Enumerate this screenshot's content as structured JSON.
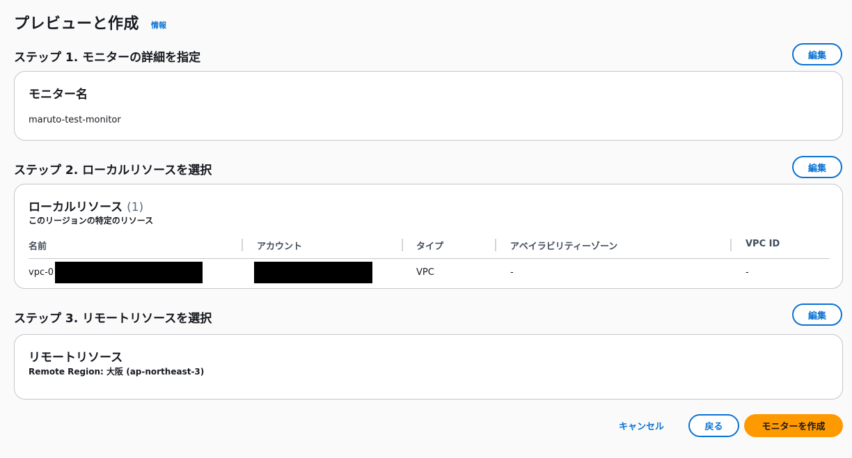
{
  "page": {
    "title": "プレビューと作成",
    "info_link": "情報"
  },
  "step1": {
    "title": "ステップ 1. モニターの詳細を指定",
    "edit_label": "編集",
    "card_header": "モニター名",
    "monitor_name": "maruto-test-monitor"
  },
  "step2": {
    "title": "ステップ 2. ローカルリソースを選択",
    "edit_label": "編集",
    "card_header": "ローカルリソース",
    "count": "(1)",
    "subtitle": "このリージョンの特定のリソース",
    "columns": [
      "名前",
      "アカウント",
      "タイプ",
      "アベイラビリティーゾーン",
      "VPC ID"
    ],
    "rows": [
      {
        "name": "vpc-0",
        "account": "",
        "type": "VPC",
        "az": "-",
        "vpc_id": "-"
      }
    ]
  },
  "step3": {
    "title": "ステップ 3. リモートリソースを選択",
    "edit_label": "編集",
    "card_header": "リモートリソース",
    "region_text": "Remote Region: 大阪 (ap-northeast-3)"
  },
  "footer": {
    "cancel_label": "キャンセル",
    "back_label": "戻る",
    "create_label": "モニターを作成"
  },
  "colors": {
    "accent": "#0972d3",
    "primary_button": "#ff9900",
    "border": "#c6c6cd"
  }
}
